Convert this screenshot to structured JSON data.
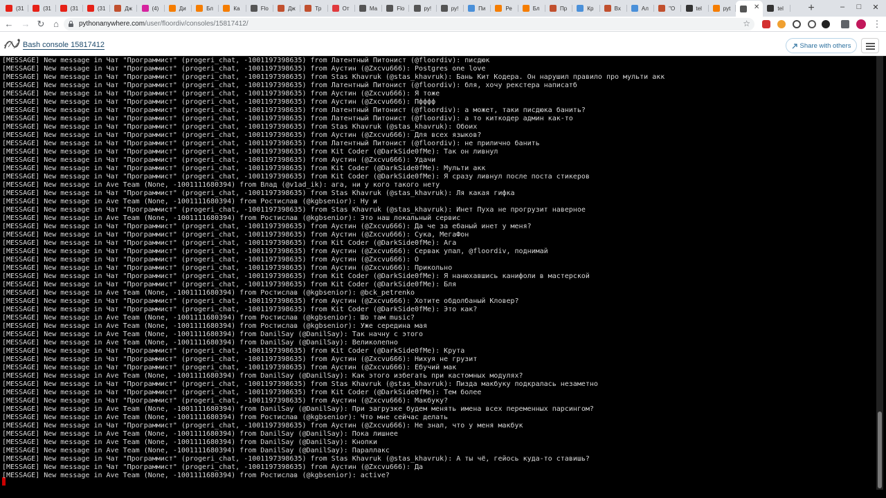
{
  "browser": {
    "tabs": [
      {
        "label": "(31",
        "color": "#e62117"
      },
      {
        "label": "(31",
        "color": "#e62117"
      },
      {
        "label": "(31",
        "color": "#e62117"
      },
      {
        "label": "(31",
        "color": "#e62117"
      },
      {
        "label": "Дж",
        "color": "#c1502e"
      },
      {
        "label": "(4)",
        "color": "#d6249f"
      },
      {
        "label": "Ди",
        "color": "#f57d00"
      },
      {
        "label": "Бл",
        "color": "#f57d00"
      },
      {
        "label": "Ка",
        "color": "#f57d00"
      },
      {
        "label": "Flo",
        "color": "#555555"
      },
      {
        "label": "Дж",
        "color": "#c1502e"
      },
      {
        "label": "Тр",
        "color": "#c1502e"
      },
      {
        "label": "От",
        "color": "#e03a3e"
      },
      {
        "label": "Ма",
        "color": "#555555"
      },
      {
        "label": "Flo",
        "color": "#555555"
      },
      {
        "label": "ру!",
        "color": "#555555"
      },
      {
        "label": "ру!",
        "color": "#555555"
      },
      {
        "label": "Пи",
        "color": "#4a90d9"
      },
      {
        "label": "Ре",
        "color": "#f57d00"
      },
      {
        "label": "Бл",
        "color": "#f57d00"
      },
      {
        "label": "Пр",
        "color": "#c1502e"
      },
      {
        "label": "Кр",
        "color": "#4a90d9"
      },
      {
        "label": "Вх",
        "color": "#c1502e"
      },
      {
        "label": "Ал",
        "color": "#4a90d9"
      },
      {
        "label": "\"О",
        "color": "#c1502e"
      },
      {
        "label": "tel",
        "color": "#333333"
      },
      {
        "label": "руt",
        "color": "#f57d00"
      },
      {
        "label": "",
        "color": "#555555"
      },
      {
        "label": "tel",
        "color": "#333333"
      }
    ],
    "address": {
      "host": "pythonanywhere.com",
      "path": "/user/floordiv/consoles/15817412/"
    }
  },
  "header": {
    "title": "Bash console 15817412",
    "share_label": "Share with others"
  },
  "terminal": {
    "lines": [
      "[MESSAGE] New message in Чат \"Программист\" (progeri_chat, -1001197398635) from Латентный Питонист (@floordiv): писдюк",
      "[MESSAGE] New message in Чат \"Программист\" (progeri_chat, -1001197398635) from Аустин (@Zxcvu666): Postgres one love",
      "[MESSAGE] New message in Чат \"Программист\" (progeri_chat, -1001197398635) from Stas Khavruk (@stas_khavruk): Бань Кит Кодера. Он нарушил правило про мульти акк",
      "[MESSAGE] New message in Чат \"Программист\" (progeri_chat, -1001197398635) from Латентный Питонист (@floordiv): бля, хочу рекстера написатб",
      "[MESSAGE] New message in Чат \"Программист\" (progeri_chat, -1001197398635) from Аустин (@Zxcvu666): Я тоже",
      "[MESSAGE] New message in Чат \"Программист\" (progeri_chat, -1001197398635) from Аустин (@Zxcvu666): Пфффф",
      "[MESSAGE] New message in Чат \"Программист\" (progeri_chat, -1001197398635) from Латентный Питонист (@floordiv): а может, таки писдюка банить?",
      "[MESSAGE] New message in Чат \"Программист\" (progeri_chat, -1001197398635) from Латентный Питонист (@floordiv): а то киткодер админ как-то",
      "[MESSAGE] New message in Чат \"Программист\" (progeri_chat, -1001197398635) from Stas Khavruk (@stas_khavruk): Обоих",
      "[MESSAGE] New message in Чат \"Программист\" (progeri_chat, -1001197398635) from Аустин (@Zxcvu666): Для всех языков?",
      "[MESSAGE] New message in Чат \"Программист\" (progeri_chat, -1001197398635) from Латентный Питонист (@floordiv): не прилично банить",
      "[MESSAGE] New message in Чат \"Программист\" (progeri_chat, -1001197398635) from Kit Coder (@DarkSide0fMe): Так он ливнул",
      "[MESSAGE] New message in Чат \"Программист\" (progeri_chat, -1001197398635) from Аустин (@Zxcvu666): Удачи",
      "[MESSAGE] New message in Чат \"Программист\" (progeri_chat, -1001197398635) from Kit Coder (@DarkSide0fMe): Мульти акк",
      "[MESSAGE] New message in Чат \"Программист\" (progeri_chat, -1001197398635) from Kit Coder (@DarkSide0fMe): Я сразу ливнул после поста стикеров",
      "[MESSAGE] New message in Ave Team (None, -1001111680394) from Влад (@v1ad_ik): ага, ни у кого такого нету",
      "[MESSAGE] New message in Чат \"Программист\" (progeri_chat, -1001197398635) from Stas Khavruk (@stas_khavruk): Ля какая гифка",
      "[MESSAGE] New message in Ave Team (None, -1001111680394) from Ростислав (@kgbsenior): Ну и",
      "[MESSAGE] New message in Чат \"Программист\" (progeri_chat, -1001197398635) from Stas Khavruk (@stas_khavruk): Инет Пуха не прогрузит наверное",
      "[MESSAGE] New message in Ave Team (None, -1001111680394) from Ростислав (@kgbsenior): Это наш локальный сервис",
      "[MESSAGE] New message in Чат \"Программист\" (progeri_chat, -1001197398635) from Аустин (@Zxcvu666): Да че за ебаный инет у меня?",
      "[MESSAGE] New message in Чат \"Программист\" (progeri_chat, -1001197398635) from Аустин (@Zxcvu666): Сука, МегаФон",
      "[MESSAGE] New message in Чат \"Программист\" (progeri_chat, -1001197398635) from Kit Coder (@DarkSide0fMe): Ага",
      "[MESSAGE] New message in Чат \"Программист\" (progeri_chat, -1001197398635) from Аустин (@Zxcvu666): Сервак упал, @floordiv, поднимай",
      "[MESSAGE] New message in Чат \"Программист\" (progeri_chat, -1001197398635) from Аустин (@Zxcvu666): О",
      "[MESSAGE] New message in Чат \"Программист\" (progeri_chat, -1001197398635) from Аустин (@Zxcvu666): Прикольно",
      "[MESSAGE] New message in Чат \"Программист\" (progeri_chat, -1001197398635) from Kit Coder (@DarkSide0fMe): Я нанюхавшись канифоли в мастерской",
      "[MESSAGE] New message in Чат \"Программист\" (progeri_chat, -1001197398635) from Kit Coder (@DarkSide0fMe): Бля",
      "[MESSAGE] New message in Ave Team (None, -1001111680394) from Ростислав (@kgbsenior): @bck_petrenko",
      "[MESSAGE] New message in Чат \"Программист\" (progeri_chat, -1001197398635) from Аустин (@Zxcvu666): Хотите обдолбаный Кловер?",
      "[MESSAGE] New message in Чат \"Программист\" (progeri_chat, -1001197398635) from Kit Coder (@DarkSide0fMe): Это как?",
      "[MESSAGE] New message in Ave Team (None, -1001111680394) from Ростислав (@kgbsenior): Шо там music?",
      "[MESSAGE] New message in Ave Team (None, -1001111680394) from Ростислав (@kgbsenior): Уже середина мая",
      "[MESSAGE] New message in Ave Team (None, -1001111680394) from DanilSay (@DanilSay): Так начну с этого",
      "[MESSAGE] New message in Ave Team (None, -1001111680394) from DanilSay (@DanilSay): Великолепно",
      "[MESSAGE] New message in Чат \"Программист\" (progeri_chat, -1001197398635) from Kit Coder (@DarkSide0fMe): Крута",
      "[MESSAGE] New message in Чат \"Программист\" (progeri_chat, -1001197398635) from Аустин (@Zxcvu666): Нихуя не грузит",
      "[MESSAGE] New message in Чат \"Программист\" (progeri_chat, -1001197398635) from Аустин (@Zxcvu666): Ебучий мак",
      "[MESSAGE] New message in Ave Team (None, -1001111680394) from DanilSay (@DanilSay): Как этого избегать при кастомных модулях?",
      "[MESSAGE] New message in Чат \"Программист\" (progeri_chat, -1001197398635) from Stas Khavruk (@stas_khavruk): Пизда макбуку подкралась незаметно",
      "[MESSAGE] New message in Чат \"Программист\" (progeri_chat, -1001197398635) from Kit Coder (@DarkSide0fMe): Тем более",
      "[MESSAGE] New message in Чат \"Программист\" (progeri_chat, -1001197398635) from Аустин (@Zxcvu666): Макбуку?",
      "[MESSAGE] New message in Ave Team (None, -1001111680394) from DanilSay (@DanilSay): При загрузке будем менять имена всех переменных парсингом?",
      "[MESSAGE] New message in Ave Team (None, -1001111680394) from Ростислав (@kgbsenior): Что мне сейчас делать",
      "[MESSAGE] New message in Чат \"Программист\" (progeri_chat, -1001197398635) from Аустин (@Zxcvu666): Не знал, что у меня макбук",
      "[MESSAGE] New message in Ave Team (None, -1001111680394) from DanilSay (@DanilSay): Пока лишнее",
      "[MESSAGE] New message in Ave Team (None, -1001111680394) from DanilSay (@DanilSay): Кнопки",
      "[MESSAGE] New message in Ave Team (None, -1001111680394) from DanilSay (@DanilSay): Параллакс",
      "[MESSAGE] New message in Чат \"Программист\" (progeri_chat, -1001197398635) from Stas Khavruk (@stas_khavruk): А ты чё, гейось куда-то ставишь?",
      "[MESSAGE] New message in Чат \"Программист\" (progeri_chat, -1001197398635) from Аустин (@Zxcvu666): Да",
      "[MESSAGE] New message in Ave Team (None, -1001111680394) from Ростислав (@kgbsenior): active?"
    ]
  },
  "colors": {
    "terminal_bg": "#000000",
    "terminal_fg": "#d8d8d8",
    "cursor": "#cc0000",
    "link": "#1e4a6b"
  }
}
